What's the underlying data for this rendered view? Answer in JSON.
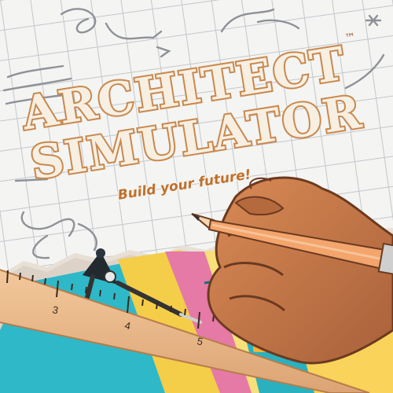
{
  "logo": {
    "line1": "ARCHITECT",
    "line2": "SIMULATOR",
    "trademark": "™",
    "tagline": "Build your future!"
  },
  "ruler": {
    "marks": [
      "3",
      "4",
      "5"
    ]
  },
  "colors": {
    "paper": "#f4f4f2",
    "grid": "#bfc2c8",
    "logo_fill": "#f7efe1",
    "logo_outline": "#c8884e",
    "tagline": "#c0702a",
    "ruler": "#e7b98a",
    "cyan": "#29b7c6",
    "pink": "#e37aa4",
    "yellow": "#f4cd49",
    "hand": "#c87a4a",
    "pencil": "#f0a26a"
  },
  "icons": [
    "drawing-compass-icon",
    "pencil-icon",
    "ruler-icon",
    "hand-icon"
  ]
}
